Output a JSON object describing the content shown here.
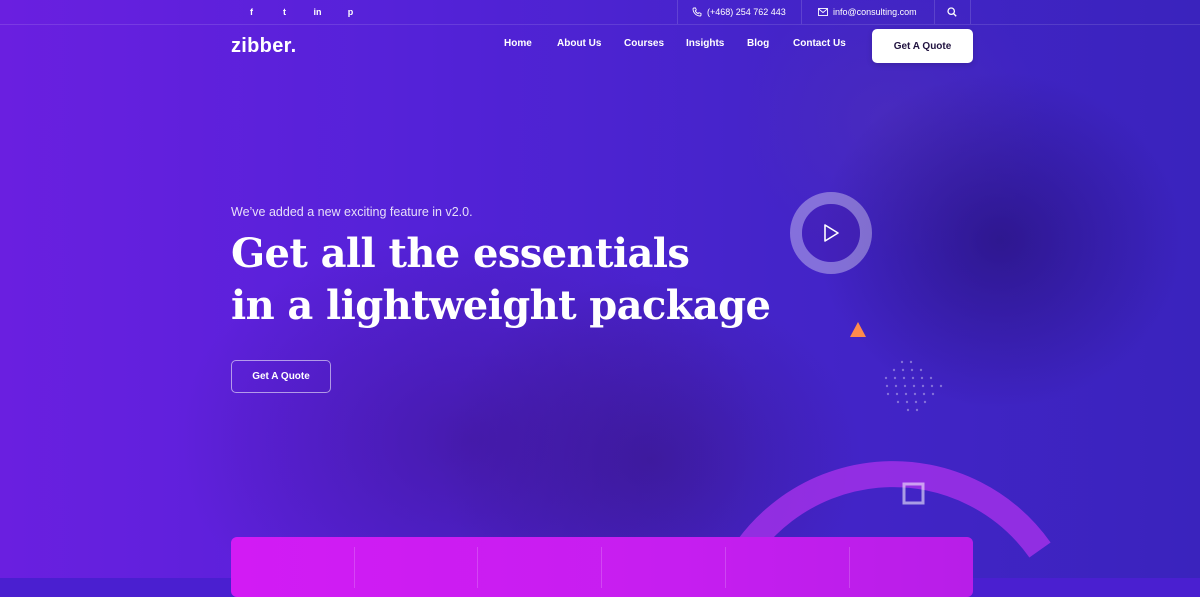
{
  "topbar": {
    "social": [
      {
        "icon": "facebook-icon",
        "glyph": "f"
      },
      {
        "icon": "twitter-icon",
        "glyph": "t"
      },
      {
        "icon": "linkedin-icon",
        "glyph": "in"
      },
      {
        "icon": "pinterest-icon",
        "glyph": "p"
      }
    ],
    "phone": "(+468) 254 762 443",
    "email": "info@consulting.com"
  },
  "header": {
    "logo": "zibber.",
    "nav": [
      "Home",
      "About Us",
      "Courses",
      "Insights",
      "Blog",
      "Contact Us"
    ],
    "cta_label": "Get A Quote"
  },
  "hero": {
    "tagline": "We’ve added a new exciting feature in v2.0.",
    "headline_line1": "Get all the essentials",
    "headline_line2": "in a lightweight package",
    "cta_label": "Get A Quote"
  },
  "colors": {
    "accent_orange": "#ff8a4c",
    "band_magenta": "#d21bf4",
    "hero_purple": "#5422d8"
  }
}
